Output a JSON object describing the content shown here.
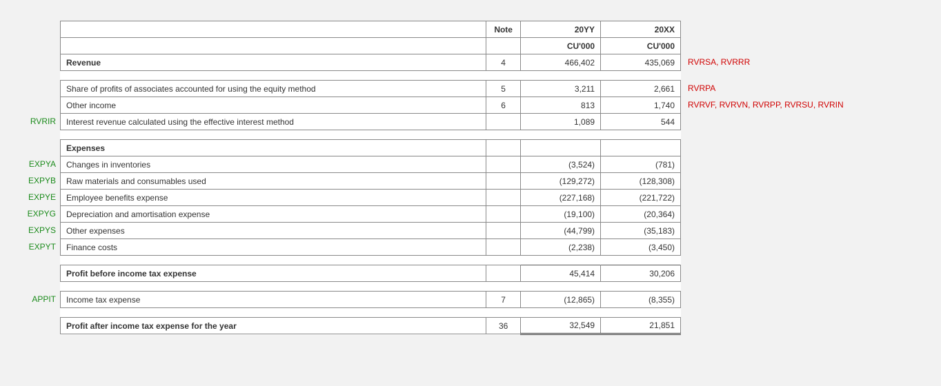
{
  "headers": {
    "blank": "",
    "note": "Note",
    "col_yy": "20YY",
    "col_xx": "20XX",
    "unit_yy": "CU'000",
    "unit_xx": "CU'000"
  },
  "rows": [
    {
      "type": "row",
      "bold": true,
      "desc": "Revenue",
      "note": "4",
      "yy": "466,402",
      "xx": "435,069",
      "left": "",
      "right": "RVRSA, RVRRR"
    },
    {
      "type": "gap"
    },
    {
      "type": "row",
      "bold": false,
      "desc": "Share of profits of associates accounted for using the equity method",
      "note": "5",
      "yy": "3,211",
      "xx": "2,661",
      "left": "",
      "right": "RVRPA"
    },
    {
      "type": "row",
      "bold": false,
      "desc": "Other income",
      "note": "6",
      "yy": "813",
      "xx": "1,740",
      "left": "",
      "right": "RVRVF, RVRVN, RVRPP, RVRSU, RVRIN"
    },
    {
      "type": "row",
      "bold": false,
      "desc": "Interest revenue calculated using the effective interest method",
      "note": "",
      "yy": "1,089",
      "xx": "544",
      "left": "RVRIR",
      "right": ""
    },
    {
      "type": "gap"
    },
    {
      "type": "row",
      "bold": true,
      "desc": "Expenses",
      "note": "",
      "yy": "",
      "xx": "",
      "left": "",
      "right": ""
    },
    {
      "type": "row",
      "bold": false,
      "desc": "Changes in inventories",
      "note": "",
      "yy": "(3,524)",
      "xx": "(781)",
      "left": "EXPYA",
      "right": ""
    },
    {
      "type": "row",
      "bold": false,
      "desc": "Raw materials and consumables used",
      "note": "",
      "yy": "(129,272)",
      "xx": "(128,308)",
      "left": "EXPYB",
      "right": ""
    },
    {
      "type": "row",
      "bold": false,
      "desc": "Employee benefits expense",
      "note": "",
      "yy": "(227,168)",
      "xx": "(221,722)",
      "left": "EXPYE",
      "right": ""
    },
    {
      "type": "row",
      "bold": false,
      "desc": "Depreciation and amortisation expense",
      "note": "",
      "yy": "(19,100)",
      "xx": "(20,364)",
      "left": "EXPYG",
      "right": ""
    },
    {
      "type": "row",
      "bold": false,
      "desc": "Other expenses",
      "note": "",
      "yy": "(44,799)",
      "xx": "(35,183)",
      "left": "EXPYS",
      "right": ""
    },
    {
      "type": "row",
      "bold": false,
      "desc": "Finance costs",
      "note": "",
      "yy": "(2,238)",
      "xx": "(3,450)",
      "left": "EXPYT",
      "right": ""
    },
    {
      "type": "gap"
    },
    {
      "type": "row",
      "bold": true,
      "desc": "Profit before income tax expense",
      "note": "",
      "yy": "45,414",
      "xx": "30,206",
      "left": "",
      "right": "",
      "subtotal": true
    },
    {
      "type": "gap"
    },
    {
      "type": "row",
      "bold": false,
      "desc": "Income tax expense",
      "note": "7",
      "yy": "(12,865)",
      "xx": "(8,355)",
      "left": "APPIT",
      "right": ""
    },
    {
      "type": "gap"
    },
    {
      "type": "row",
      "bold": true,
      "desc": "Profit after income tax expense for the year",
      "note": "36",
      "yy": "32,549",
      "xx": "21,851",
      "left": "",
      "right": "",
      "grand": true
    }
  ]
}
